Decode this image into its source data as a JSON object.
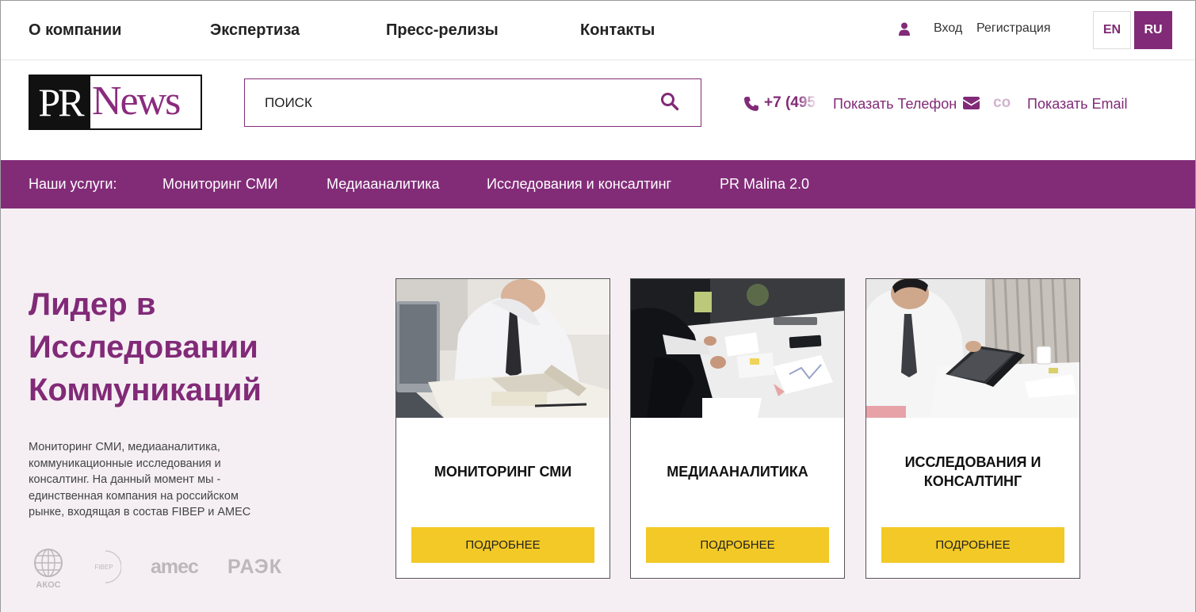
{
  "topnav": {
    "items": [
      {
        "label": "О компании"
      },
      {
        "label": "Экспертиза"
      },
      {
        "label": "Пресс-релизы"
      },
      {
        "label": "Контакты"
      }
    ],
    "login_label": "Вход",
    "register_label": "Регистрация",
    "lang_en": "EN",
    "lang_ru": "RU"
  },
  "header": {
    "logo_pr": "PR",
    "logo_news": "News",
    "search_placeholder": "ПОИСК",
    "phone_partial": "+7 (495",
    "show_phone_label": "Показать Телефон",
    "email_partial": "co",
    "show_email_label": "Показать Email"
  },
  "services": {
    "intro": "Наши услуги:",
    "items": [
      {
        "label": "Мониторинг СМИ"
      },
      {
        "label": "Медиааналитика"
      },
      {
        "label": "Исследования и консалтинг"
      },
      {
        "label": "PR Malina 2.0"
      }
    ]
  },
  "hero": {
    "title": "Лидер в Исследовании Коммуникаций",
    "description": "Мониторинг СМИ, медиааналитика, коммуникационные исследования и консалтинг. На данный момент мы - единственная компания на российском рынке, входящая в состав FIBEP и AMEC"
  },
  "partners": {
    "akos": "АКОС",
    "fibep": "FIBEP",
    "amec": "amec",
    "raek": "РАЭК"
  },
  "cards": [
    {
      "title": "МОНИТОРИНГ СМИ",
      "button": "ПОДРОБНЕЕ"
    },
    {
      "title": "МЕДИААНАЛИТИКА",
      "button": "ПОДРОБНЕЕ"
    },
    {
      "title": "ИССЛЕДОВАНИЯ И КОНСАЛТИНГ",
      "button": "ПОДРОБНЕЕ"
    }
  ],
  "colors": {
    "brand_purple": "#812a77",
    "button_yellow": "#f2c926",
    "main_background": "#f5eff4"
  },
  "icons": {
    "user": "user-icon",
    "search": "search-icon",
    "phone": "phone-icon",
    "mail": "mail-icon"
  }
}
